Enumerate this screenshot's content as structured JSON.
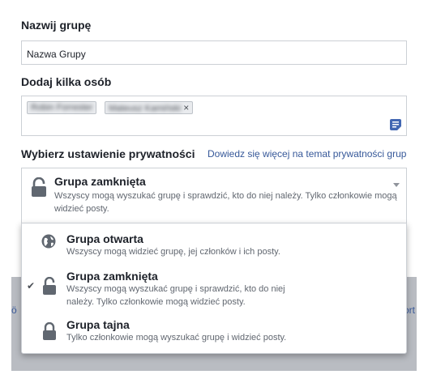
{
  "form": {
    "group_name_label": "Nazwij grupę",
    "group_name_value": "Nazwa Grupy",
    "add_people_label": "Dodaj kilka osób",
    "people_tokens": [
      "Robin Forrester",
      "Mateusz Kamiński"
    ],
    "token_remove_glyph": "×",
    "privacy_label": "Wybierz ustawienie prywatności",
    "privacy_learn_more": "Dowiedz się więcej na temat prywatności grup"
  },
  "privacy_select": {
    "selected_title": "Grupa zamknięta",
    "selected_description": "Wszyscy mogą wyszukać grupę i sprawdzić, kto do niej należy. Tylko członkowie mogą widzieć posty."
  },
  "privacy_menu": {
    "options": [
      {
        "icon": "globe-icon",
        "title": "Grupa otwarta",
        "description": "Wszyscy mogą widzieć grupę, jej członków i ich posty.",
        "selected": false
      },
      {
        "icon": "lock-open-icon",
        "title": "Grupa zamknięta",
        "description": "Wszyscy mogą wyszukać grupę i sprawdzić, kto do niej należy. Tylko członkowie mogą widzieć posty.",
        "selected": true
      },
      {
        "icon": "lock-icon",
        "title": "Grupa tajna",
        "description": "Tylko członkowie mogą wyszukać grupę i widzieć posty.",
        "selected": false
      }
    ],
    "check_glyph": "✔"
  },
  "background": {
    "left_fragment": "ö",
    "right_fragment": "ort"
  },
  "colors": {
    "link": "#365899",
    "border": "#ccd0d5",
    "overlay": "#b9bcc2",
    "text": "#1d2129",
    "secondary_text": "#616770"
  }
}
